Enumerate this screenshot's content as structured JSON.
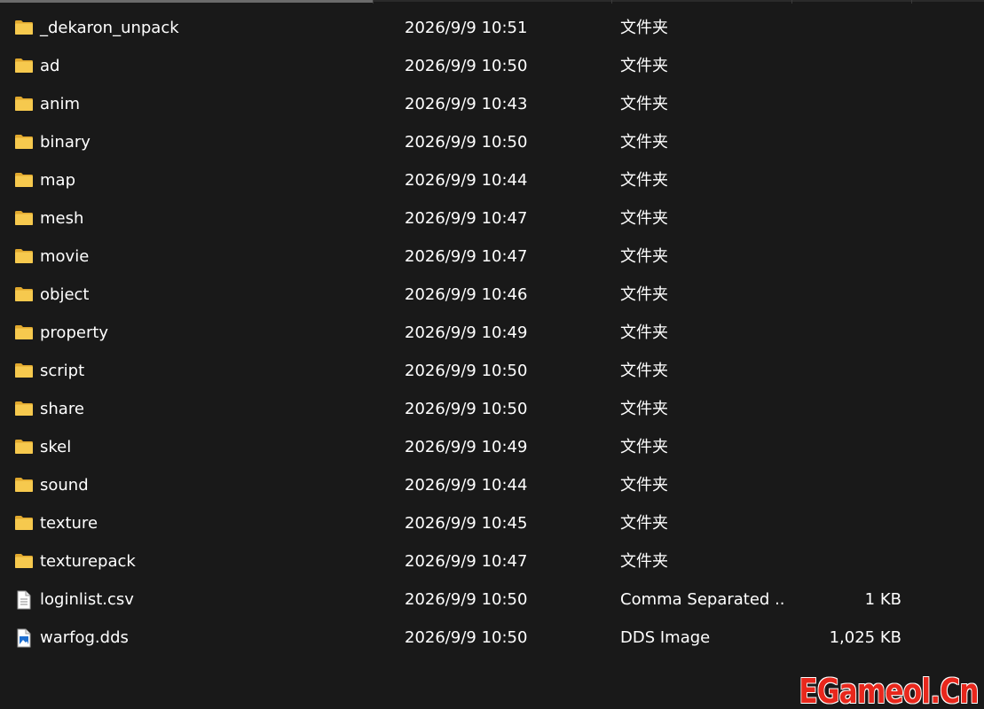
{
  "colors": {
    "background": "#191919",
    "text": "#ffffff",
    "folder": "#f6c94e",
    "watermark": "#e8271c"
  },
  "files": [
    {
      "name": "_dekaron_unpack",
      "date": "2026/9/9 10:51",
      "type": "文件夹",
      "size": "",
      "icon": "folder-icon"
    },
    {
      "name": "ad",
      "date": "2026/9/9 10:50",
      "type": "文件夹",
      "size": "",
      "icon": "folder-icon"
    },
    {
      "name": "anim",
      "date": "2026/9/9 10:43",
      "type": "文件夹",
      "size": "",
      "icon": "folder-icon"
    },
    {
      "name": "binary",
      "date": "2026/9/9 10:50",
      "type": "文件夹",
      "size": "",
      "icon": "folder-icon"
    },
    {
      "name": "map",
      "date": "2026/9/9 10:44",
      "type": "文件夹",
      "size": "",
      "icon": "folder-icon"
    },
    {
      "name": "mesh",
      "date": "2026/9/9 10:47",
      "type": "文件夹",
      "size": "",
      "icon": "folder-icon"
    },
    {
      "name": "movie",
      "date": "2026/9/9 10:47",
      "type": "文件夹",
      "size": "",
      "icon": "folder-icon"
    },
    {
      "name": "object",
      "date": "2026/9/9 10:46",
      "type": "文件夹",
      "size": "",
      "icon": "folder-icon"
    },
    {
      "name": "property",
      "date": "2026/9/9 10:49",
      "type": "文件夹",
      "size": "",
      "icon": "folder-icon"
    },
    {
      "name": "script",
      "date": "2026/9/9 10:50",
      "type": "文件夹",
      "size": "",
      "icon": "folder-icon"
    },
    {
      "name": "share",
      "date": "2026/9/9 10:50",
      "type": "文件夹",
      "size": "",
      "icon": "folder-icon"
    },
    {
      "name": "skel",
      "date": "2026/9/9 10:49",
      "type": "文件夹",
      "size": "",
      "icon": "folder-icon"
    },
    {
      "name": "sound",
      "date": "2026/9/9 10:44",
      "type": "文件夹",
      "size": "",
      "icon": "folder-icon"
    },
    {
      "name": "texture",
      "date": "2026/9/9 10:45",
      "type": "文件夹",
      "size": "",
      "icon": "folder-icon"
    },
    {
      "name": "texturepack",
      "date": "2026/9/9 10:47",
      "type": "文件夹",
      "size": "",
      "icon": "folder-icon"
    },
    {
      "name": "loginlist.csv",
      "date": "2026/9/9 10:50",
      "type": "Comma Separated ...",
      "size": "1 KB",
      "icon": "document-icon"
    },
    {
      "name": "warfog.dds",
      "date": "2026/9/9 10:50",
      "type": "DDS Image",
      "size": "1,025 KB",
      "icon": "image-file-icon"
    }
  ],
  "watermark": {
    "text": "EGameol.Cn"
  }
}
